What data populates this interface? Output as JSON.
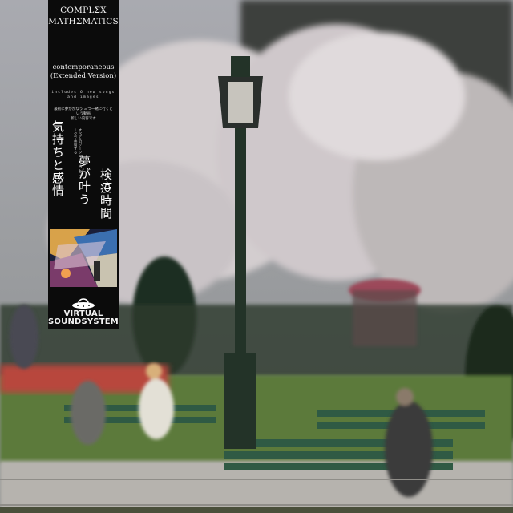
{
  "obi": {
    "artist_line1": "COMPLΣX",
    "artist_line2": "MATHΣMATICS",
    "album_title_line1": "contemporaneous",
    "album_title_line2": "(Extended Version)",
    "tagline_line1": "includes 6 new songs",
    "tagline_line2": "and images",
    "small_jp_line1": "最初に夢がかなう 三つ一緒に行くという動画",
    "small_jp_line2": "新しい内容です",
    "vertical_1": "気持ちと感情",
    "vertical_2_line1": "すべてのソーシャルネットワ",
    "vertical_2_line2": "ークで共有する",
    "vertical_3": "夢が叶う",
    "vertical_4": "検疫時間",
    "label_line1": "VIRTUAL",
    "label_line2": "SOUNDSYSTEM",
    "label_icon": "ufo-icon"
  },
  "photo": {
    "scene": "park-scene-image"
  },
  "colors": {
    "obi_bg": "#0b0b0b",
    "obi_text": "#f2f2f2",
    "grass": "#5b7a3a",
    "bench": "#2f5a44",
    "blossom": "#d9d2d4"
  }
}
